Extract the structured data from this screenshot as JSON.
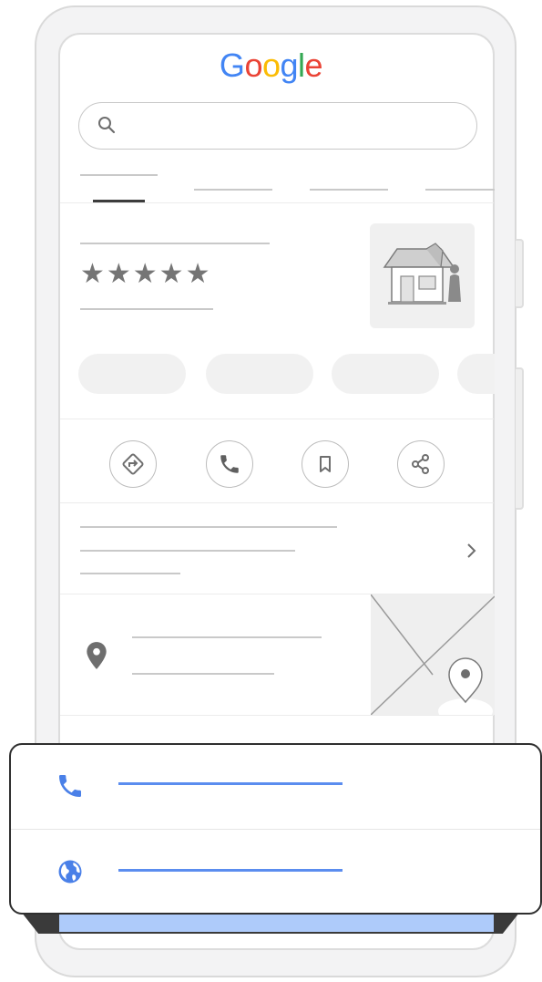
{
  "header": {
    "logo_letters": [
      {
        "char": "G",
        "color": "#4285F4"
      },
      {
        "char": "o",
        "color": "#EA4335"
      },
      {
        "char": "o",
        "color": "#FBBC05"
      },
      {
        "char": "g",
        "color": "#4285F4"
      },
      {
        "char": "l",
        "color": "#34A853"
      },
      {
        "char": "e",
        "color": "#EA4335"
      }
    ]
  },
  "listing": {
    "rating_stars": "★★★★★",
    "rating_value": 5
  },
  "action_icons": [
    "directions-icon",
    "phone-icon",
    "bookmark-icon",
    "share-icon"
  ],
  "contact_card": {
    "rows": [
      "phone-icon",
      "globe-icon"
    ],
    "accent_color": "#4a80e8"
  },
  "colors": {
    "placeholder_line": "#c9c9c9",
    "icon_gray": "#6e6e6e",
    "accent_blue": "#5b8def",
    "selected_strip": "#aecbfa"
  }
}
